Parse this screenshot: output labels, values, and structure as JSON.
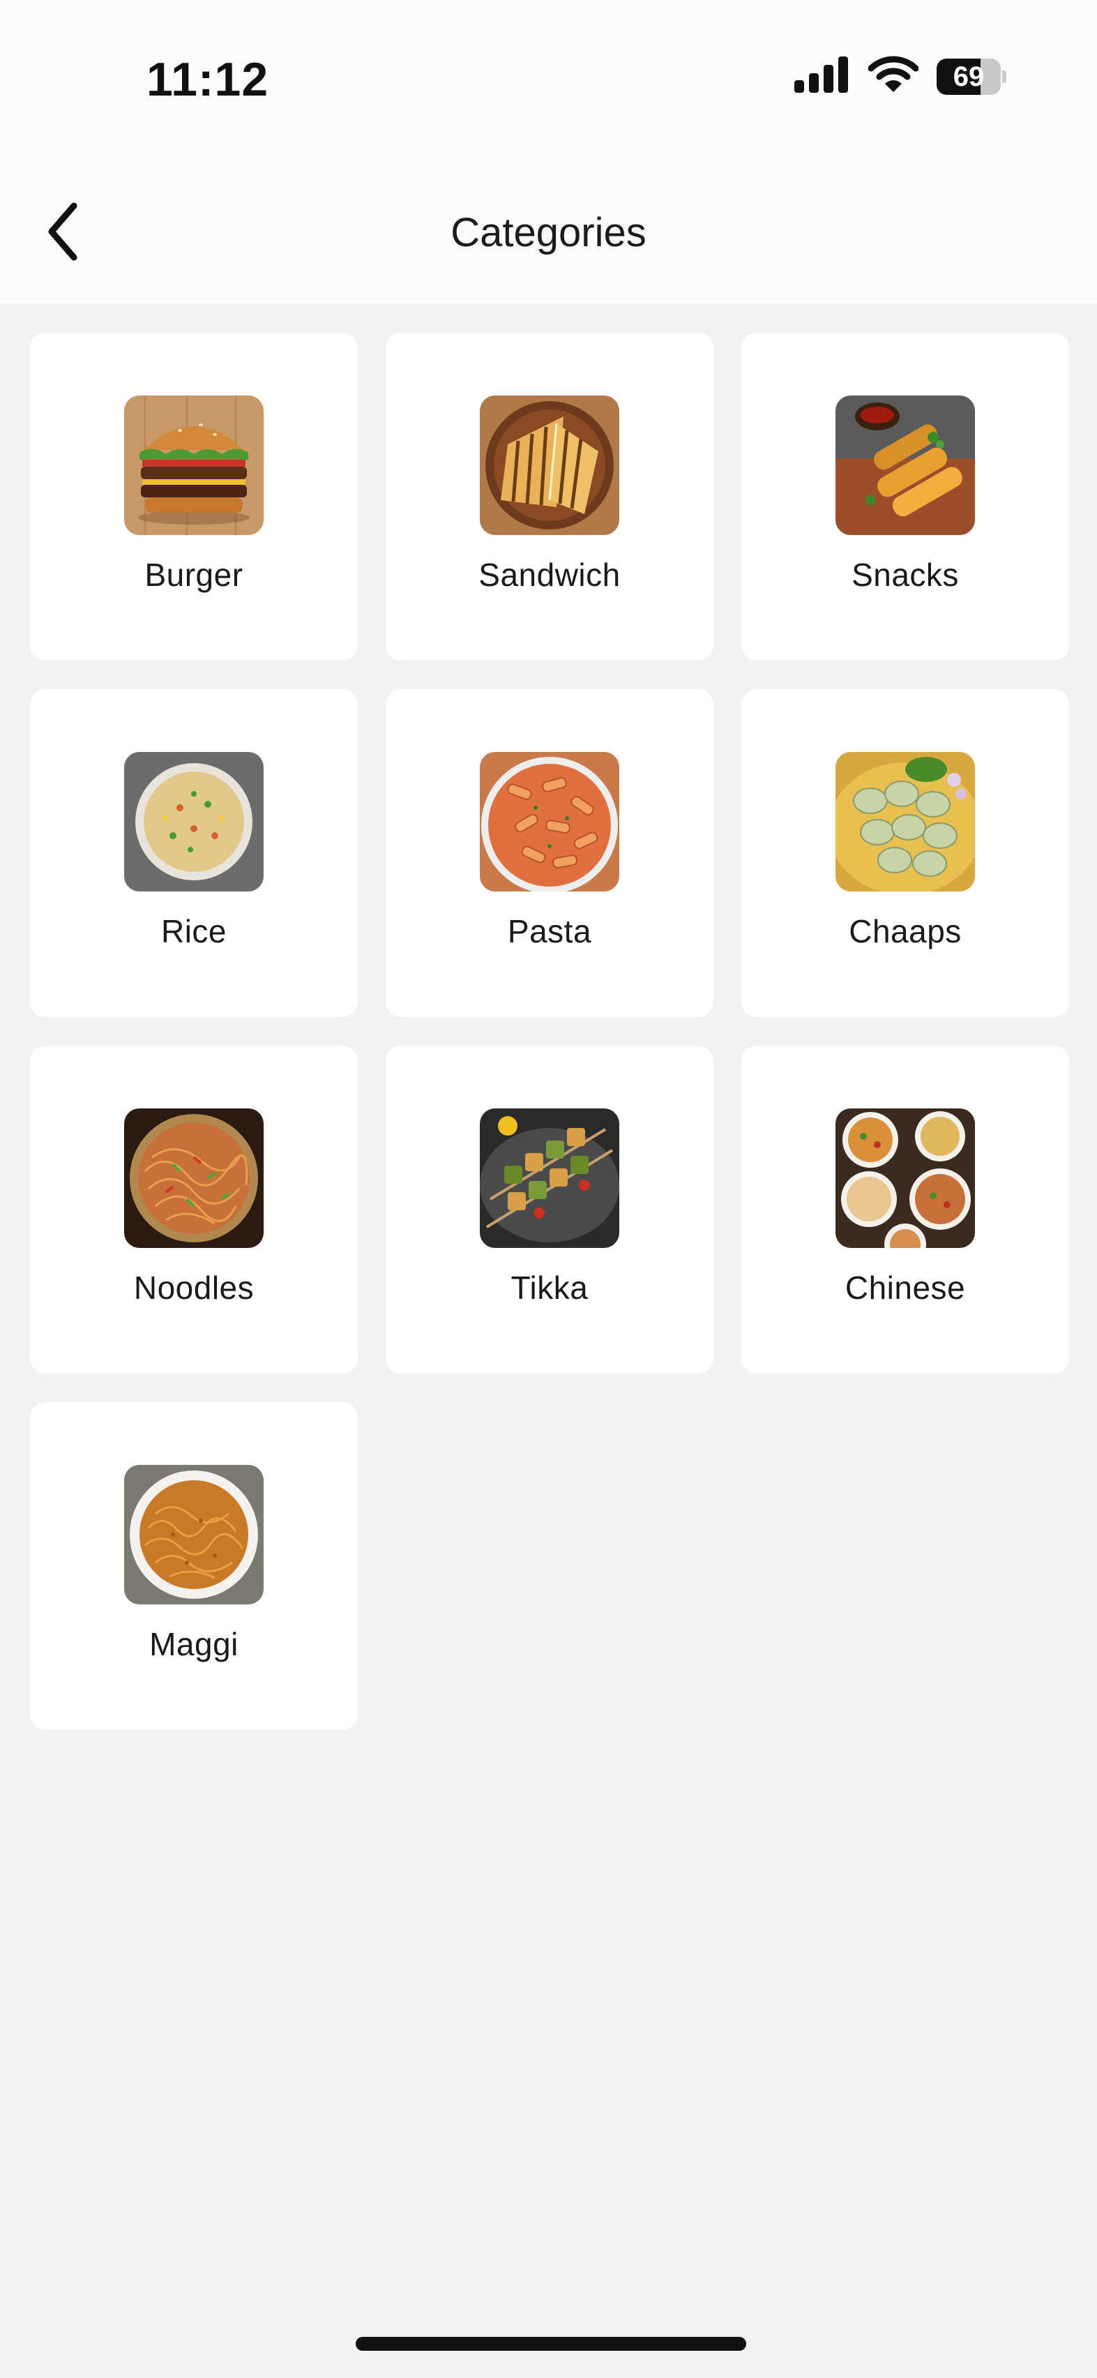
{
  "status_bar": {
    "time": "11:12",
    "battery": "69",
    "battery_level": 0.69,
    "icons": [
      "cellular-signal-icon",
      "wifi-icon",
      "battery-icon"
    ]
  },
  "header": {
    "back_icon": "chevron-left-icon",
    "title": "Categories"
  },
  "categories": [
    {
      "label": "Burger"
    },
    {
      "label": "Sandwich"
    },
    {
      "label": "Snacks"
    },
    {
      "label": "Rice"
    },
    {
      "label": "Pasta"
    },
    {
      "label": "Chaaps"
    },
    {
      "label": "Noodles"
    },
    {
      "label": "Tikka"
    },
    {
      "label": "Chinese"
    },
    {
      "label": "Maggi"
    }
  ],
  "colors": {
    "background": "#f2f2f2",
    "card": "#ffffff",
    "text": "#1a1a1a"
  }
}
